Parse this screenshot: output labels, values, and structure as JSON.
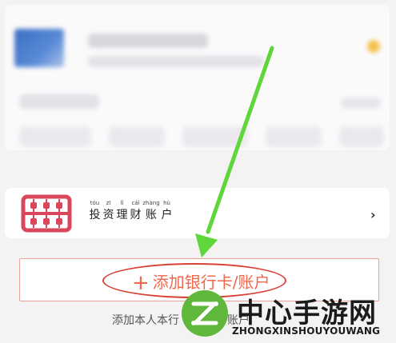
{
  "invest_account": {
    "chars": [
      {
        "py": "tóu",
        "hz": "投"
      },
      {
        "py": "zī",
        "hz": "资"
      },
      {
        "py": "lǐ",
        "hz": "理"
      },
      {
        "py": "cái",
        "hz": "财"
      },
      {
        "py": "zhàng",
        "hz": "账"
      },
      {
        "py": "hù",
        "hz": "户"
      }
    ],
    "chevron": "›",
    "icon": "abacus-icon"
  },
  "add_card": {
    "plus": "+",
    "label": "添加银行卡/账户"
  },
  "bottom_note": "添加本人本行",
  "bottom_note_tail": "银行账户",
  "watermark": {
    "title": "中心手游网",
    "subtitle": "ZHONGXINSHOUYOUWANG"
  },
  "colors": {
    "accent": "#f0674b",
    "annotation_red": "#d94236",
    "arrow_green": "#5fd63a",
    "abacus_red": "#d9475a"
  }
}
